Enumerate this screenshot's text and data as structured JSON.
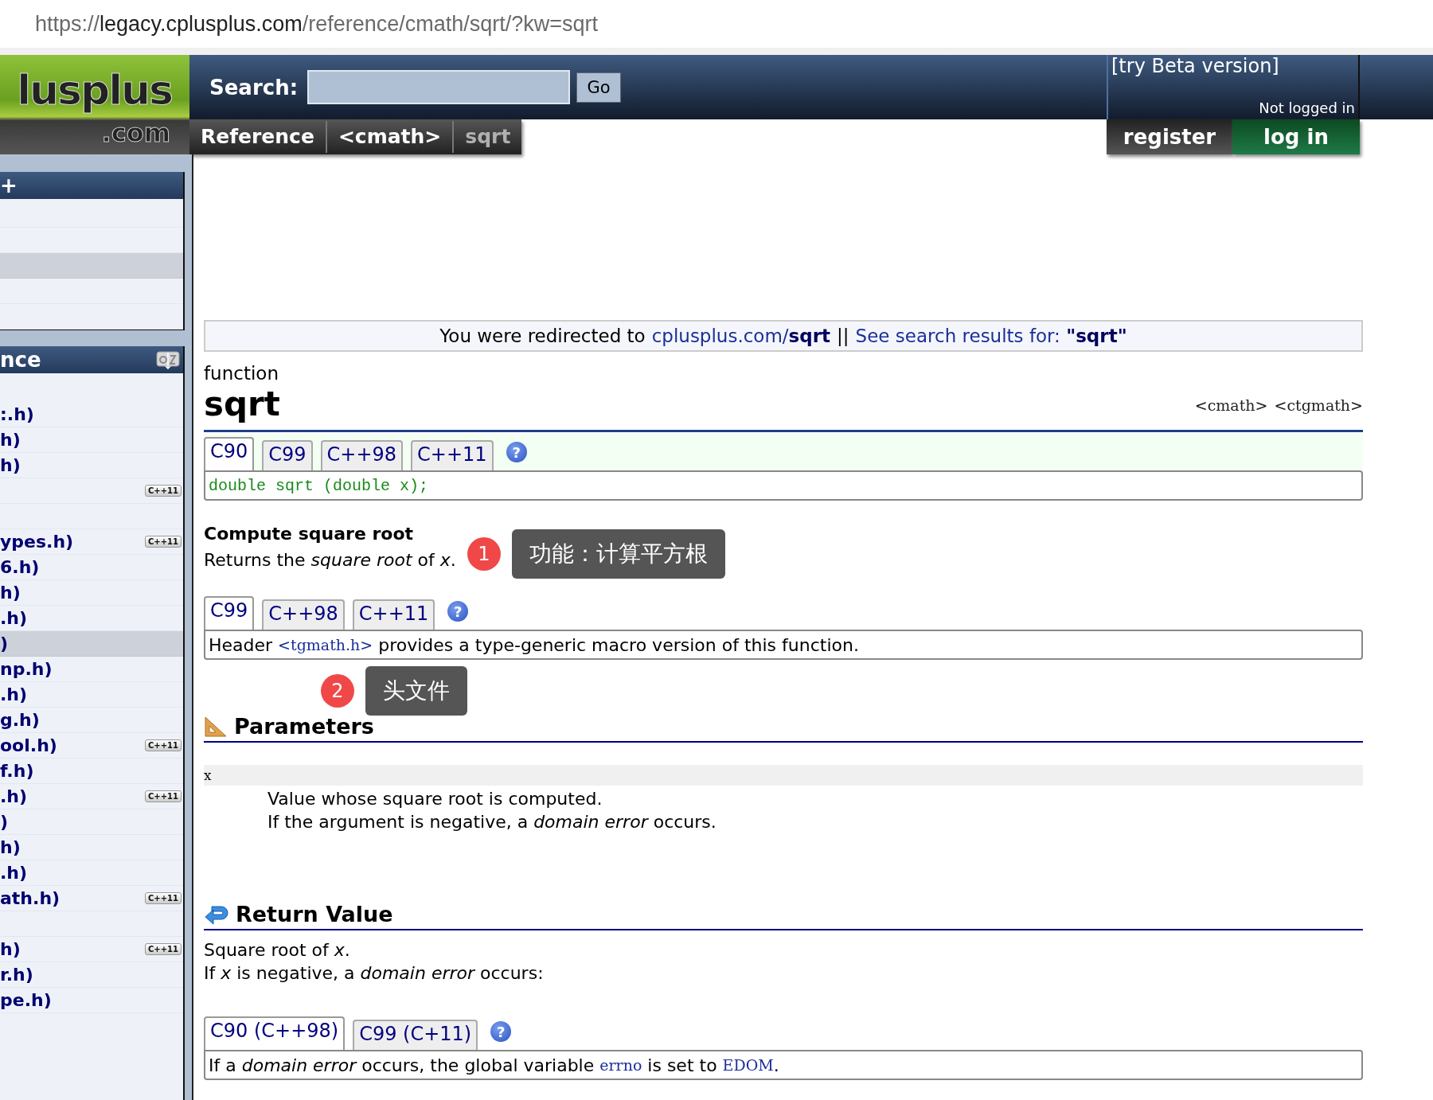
{
  "address_bar": {
    "scheme": "https://",
    "host": "legacy.cplusplus.com",
    "path": "/reference/cmath/sqrt/?kw=sqrt"
  },
  "logo": {
    "word": "lusplus",
    "suffix": ".com"
  },
  "search": {
    "label": "Search:",
    "button": "Go"
  },
  "beta_link": "[try Beta version]",
  "login_status": "Not logged in",
  "breadcrumbs": [
    {
      "label": "Reference",
      "selected": false
    },
    {
      "label": "<cmath>",
      "selected": false
    },
    {
      "label": "sqrt",
      "selected": true
    }
  ],
  "account_buttons": [
    {
      "label": "register",
      "kind": "register"
    },
    {
      "label": "log in",
      "kind": "login"
    }
  ],
  "sidebar": {
    "boxes": [
      {
        "title": "+",
        "sortable": false,
        "items": [
          {
            "selected": false
          },
          {
            "selected": false
          },
          {
            "selected": true
          },
          {
            "selected": false
          },
          {
            "selected": false
          }
        ]
      },
      {
        "title": "nce",
        "sortable": true,
        "items": [
          {
            "text": ":.h)",
            "selected": false
          },
          {
            "text": "h)",
            "selected": false
          },
          {
            "text": "h)",
            "selected": false
          },
          {
            "badge": "C++11",
            "selected": false
          },
          {
            "selected": false
          },
          {
            "text": "ypes.h)",
            "badge": "C++11",
            "selected": false
          },
          {
            "text": "6.h)",
            "selected": false
          },
          {
            "text": "h)",
            "selected": false
          },
          {
            "text": ".h)",
            "selected": false
          },
          {
            "text": ")",
            "selected": true
          },
          {
            "text": "np.h)",
            "selected": false
          },
          {
            "text": ".h)",
            "selected": false
          },
          {
            "text": "g.h)",
            "selected": false
          },
          {
            "text": "ool.h)",
            "badge": "C++11",
            "selected": false
          },
          {
            "text": "f.h)",
            "selected": false
          },
          {
            "text": ".h)",
            "badge": "C++11",
            "selected": false
          },
          {
            "text": ")",
            "selected": false
          },
          {
            "text": "h)",
            "selected": false
          },
          {
            "text": ".h)",
            "selected": false
          },
          {
            "text": "ath.h)",
            "badge": "C++11",
            "selected": false
          },
          {
            "selected": false
          },
          {
            "text": "h)",
            "badge": "C++11",
            "selected": false
          },
          {
            "text": "r.h)",
            "selected": false
          },
          {
            "text": "pe.h)",
            "selected": false
          }
        ]
      }
    ]
  },
  "redirect": {
    "text": "You were redirected to",
    "link": "cplusplus.com/**sqrt**",
    "separator": "||",
    "search_link": "See search results for: **\"sqrt\"**"
  },
  "entry_kind": "function",
  "name": "sqrt",
  "headers": [
    "<cmath>",
    "<ctgmath>"
  ],
  "prototype": {
    "tabs": [
      {
        "label": "C90",
        "selected": true
      },
      {
        "label": "C99",
        "selected": false
      },
      {
        "label": "C++98",
        "selected": false
      },
      {
        "label": "C++11",
        "selected": false
      }
    ],
    "help": "?",
    "code": "double sqrt (double x);"
  },
  "summary": "Compute square root",
  "description": "Returns the *square root* of *x*.",
  "annotations": [
    {
      "number": "1",
      "text": "功能：计算平方根"
    },
    {
      "number": "2",
      "text": "头文件"
    }
  ],
  "header_note": {
    "tabs": [
      {
        "label": "C99",
        "selected": true
      },
      {
        "label": "C++98",
        "selected": false
      },
      {
        "label": "C++11",
        "selected": false
      }
    ],
    "help": "?",
    "parts": [
      {
        "kind": "text",
        "text": "Header "
      },
      {
        "kind": "code",
        "text": "<tgmath.h>"
      },
      {
        "kind": "text",
        "text": " provides a type-generic macro version of this function."
      }
    ]
  },
  "parameters": {
    "title": "Parameters",
    "items": [
      {
        "name": "x",
        "lines": [
          "Value whose square root is computed.",
          "If the argument is negative, a *domain error* occurs."
        ]
      }
    ]
  },
  "return_value": {
    "title": "Return Value",
    "lines": [
      "Square root of *x*.",
      "If *x* is negative, a *domain error* occurs:"
    ]
  },
  "errno_note": {
    "tabs": [
      {
        "label": "C90 (C++98)",
        "selected": true
      },
      {
        "label": "C99 (C+11)",
        "selected": false
      }
    ],
    "help": "?",
    "parts": [
      {
        "kind": "text",
        "text": "If a *domain error* occurs, the global variable "
      },
      {
        "kind": "code",
        "text": "errno"
      },
      {
        "kind": "text",
        "text": " is set to "
      },
      {
        "kind": "code",
        "text": "EDOM"
      },
      {
        "kind": "text",
        "text": "."
      }
    ]
  }
}
